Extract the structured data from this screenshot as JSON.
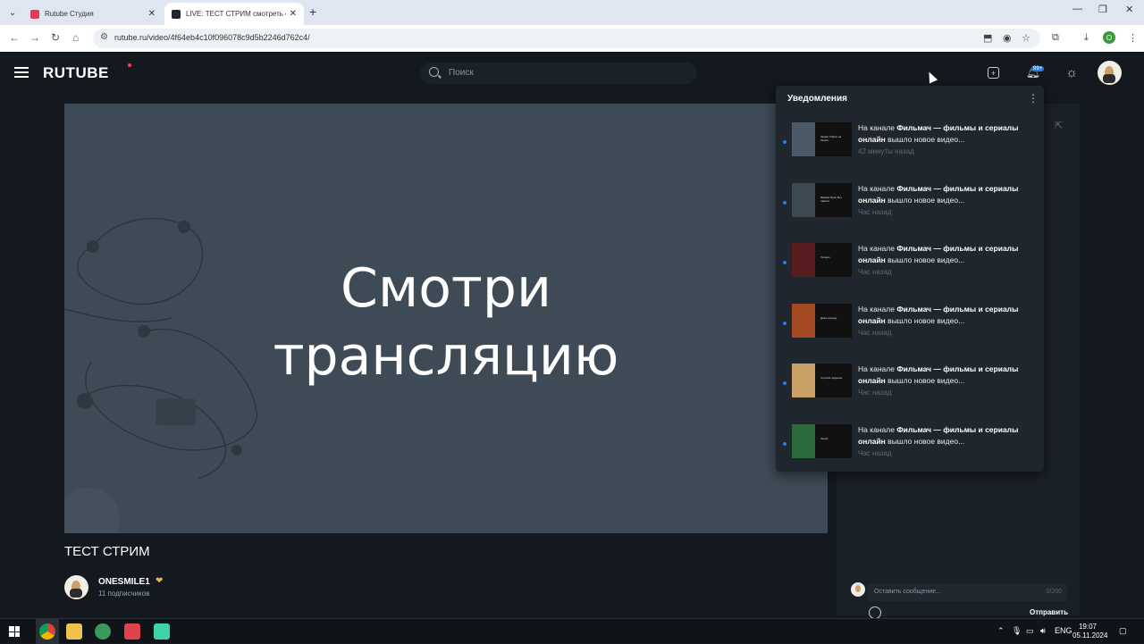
{
  "browser": {
    "tabs": [
      {
        "title": "Rutube Студия",
        "favicon_color": "#e43b5c"
      },
      {
        "title": "LIVE: ТЕСТ СТРИМ смотреть он...",
        "favicon_color": "#1e2530"
      }
    ],
    "url": "rutube.ru/video/4f64eb4c10f096078c9d5b2246d762c4/",
    "profile_letter": "O"
  },
  "site": {
    "logo": "RUTUBE",
    "search_placeholder": "Поиск",
    "bell_badge": "99+"
  },
  "player": {
    "line1": "Смотри",
    "line2": "трансляцию"
  },
  "video": {
    "title": "ТЕСТ СТРИМ",
    "channel_name": "ONESMILE1",
    "subscribers": "11 подписчиков"
  },
  "chat": {
    "placeholder": "Оставить сообщение...",
    "counter": "0/200",
    "send_label": "Отправить"
  },
  "notifications": {
    "header": "Уведомления",
    "items": [
      {
        "prefix": "На канале ",
        "channel": "Фильмач — фильмы и сериалы онлайн",
        "suffix": " вышло новое видео...",
        "time": "42 минуты назад",
        "color": "#4b5a66",
        "caption": "Захват Райли на Земле"
      },
      {
        "prefix": "На канале ",
        "channel": "Фильмач — фильмы и сериалы онлайн",
        "suffix": " вышло новое видео...",
        "time": "Час назад",
        "color": "#3d4a52",
        "caption": "Варвар Бумс Без памяти"
      },
      {
        "prefix": "На канале ",
        "channel": "Фильмач — фильмы и сериалы онлайн",
        "suffix": " вышло новое видео...",
        "time": "Час назад",
        "color": "#5a1d1f",
        "caption": "Хилари"
      },
      {
        "prefix": "На канале ",
        "channel": "Фильмач — фильмы и сериалы онлайн",
        "suffix": " вышло новое видео...",
        "time": "Час назад",
        "color": "#a34a22",
        "caption": "Даже вперед"
      },
      {
        "prefix": "На канале ",
        "channel": "Фильмач — фильмы и сериалы онлайн",
        "suffix": " вышло новое видео...",
        "time": "Час назад",
        "color": "#c9a066",
        "caption": "Горячая подмена"
      },
      {
        "prefix": "На канале ",
        "channel": "Фильмач — фильмы и сериалы онлайн",
        "suffix": " вышло новое видео...",
        "time": "Час назад",
        "color": "#2b6a3a",
        "caption": "Лепка"
      }
    ]
  },
  "taskbar": {
    "lang": "ENG",
    "time": "19:07",
    "date": "05.11.2024"
  }
}
